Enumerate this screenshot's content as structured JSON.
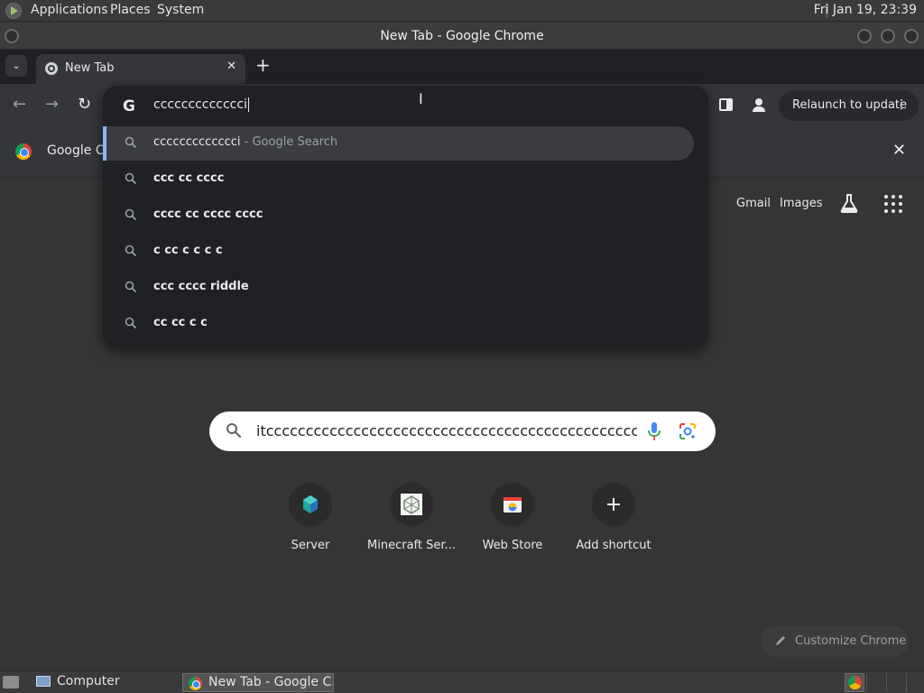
{
  "top_panel": {
    "menus": [
      "Applications",
      "Places",
      "System"
    ],
    "clock": "Fri Jan 19, 23:39"
  },
  "window": {
    "title": "New Tab - Google Chrome"
  },
  "tabs": {
    "active_tab_title": "New Tab",
    "close_glyph": "✕",
    "new_tab_glyph": "+",
    "tab_search_glyph": "⌄"
  },
  "toolbar": {
    "back_glyph": "←",
    "forward_glyph": "→",
    "reload_glyph": "↻",
    "relaunch_label": "Relaunch to update",
    "menu_glyph": "⋮"
  },
  "infobar": {
    "text": "Google Ch",
    "close_glyph": "✕"
  },
  "omnibox": {
    "logo": "G",
    "input_value": "ccccccccccccci",
    "suggestions": [
      {
        "text": "ccccccccccccci",
        "suffix": " - Google Search"
      },
      {
        "text": "ccc cc cccc"
      },
      {
        "text": "cccc cc cccc cccc"
      },
      {
        "text": "c cc c c c c"
      },
      {
        "text": "ccc cccc riddle"
      },
      {
        "text": "cc cc c c"
      }
    ]
  },
  "ntp": {
    "gmail_label": "Gmail",
    "images_label": "Images",
    "search_value": "itccccccccccccccccccccccccccccccccccccccccccccccccccccccccc",
    "shortcuts": [
      {
        "label": "Server"
      },
      {
        "label": "Minecraft Ser..."
      },
      {
        "label": "Web Store"
      },
      {
        "label": "Add shortcut"
      }
    ],
    "customize_label": "Customize Chrome"
  },
  "taskbar": {
    "computer_label": "Computer",
    "chrome_label": "New Tab - Google C..."
  },
  "colors": {
    "accent": "#8ab4f8",
    "omnibox_bg": "#202124",
    "toolbar_bg": "#35363a",
    "page_bg": "#353535"
  }
}
